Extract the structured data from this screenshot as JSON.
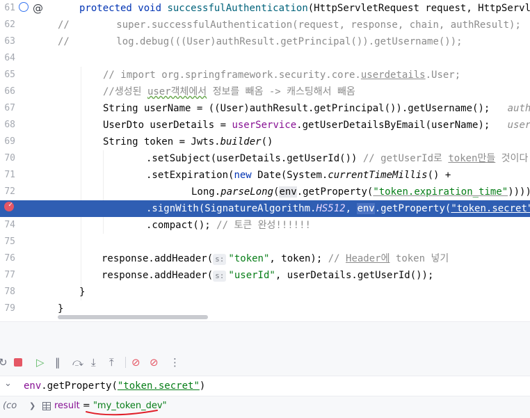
{
  "editor": {
    "line_numbers": [
      "61",
      "62",
      "63",
      "64",
      "65",
      "66",
      "67",
      "68",
      "69",
      "70",
      "71",
      "72",
      "73",
      "74",
      "75",
      "76",
      "77",
      "78",
      "79"
    ],
    "lines": {
      "l61": {
        "kw1": "protected",
        "kw2": "void",
        "meth": "successfulAuthentication",
        "rest": "(HttpServletRequest request, HttpServletRe"
      },
      "l62": "//        super.successfulAuthentication(request, response, chain, authResult);",
      "l63": "//        log.debug(((User)authResult.getPrincipal()).getUsername());",
      "l66": {
        "a": "// import org.springframework.security.core.",
        "b": "userdetails",
        "c": ".User;"
      },
      "l67": {
        "a": "//생성된 ",
        "b": "user객체에서",
        "c": " 정보를 빼옴 -> 캐스팅해서 빼옴"
      },
      "l68": {
        "code": "String userName = ((User)authResult.getPrincipal()).getUsername();",
        "hint": "authResul"
      },
      "l69": {
        "a": "UserDto userDetails = ",
        "field": "userService",
        "b": ".getUserDetailsByEmail(userName);",
        "hint": "userName:"
      },
      "l70": {
        "a": "String token = Jwts.",
        "it": "builder",
        "b": "()"
      },
      "l71": {
        "a": ".setSubject(userDetails.getUserId()) ",
        "c1": "// getUserId로 ",
        "c2": "token만들",
        "c3": " 것이다"
      },
      "l72": {
        "a": ".setExpiration(",
        "kw": "new",
        "b": " Date(System.",
        "it": "currentTimeMillis",
        "c": "() +"
      },
      "l73": {
        "a": "Long.",
        "it": "parseLong",
        "b": "(",
        "env": "env",
        "c": ".getProperty(",
        "str": "\"token.expiration_time\"",
        "d": ")))) //"
      },
      "l74": {
        "a": ".signWith(SignatureAlgorithm.",
        "hs": "HS512",
        "b": ", ",
        "env": "env",
        "c": ".getProperty(",
        "str": "\"token.secret\"",
        "d": "))"
      },
      "l75": {
        "a": ".compact(); ",
        "c": "// 토큰 완성!!!!!!"
      },
      "l77": {
        "a": "response.addHeader(",
        "hint": "s:",
        "str": "\"token\"",
        "b": ", token); ",
        "c1": "// ",
        "c2": "Header에",
        "c3": " token 넣기"
      },
      "l78": {
        "a": "response.addHeader(",
        "hint": "s:",
        "str": "\"userId\"",
        "b": ", userDetails.getUserId());"
      },
      "l79": "}",
      "l80": "}"
    }
  },
  "debug_toolbar": {
    "icons": [
      "rerun-icon",
      "stop-icon",
      "resume-icon",
      "pause-icon",
      "step-over-icon",
      "step-into-icon",
      "step-out-icon",
      "view-breakpoints-icon",
      "mute-breakpoints-icon",
      "more-icon"
    ]
  },
  "evaluate": {
    "expr_a": "env",
    "expr_b": ".getProperty(",
    "expr_str": "\"token.secret\"",
    "expr_c": ")"
  },
  "result": {
    "frame_label": "(co",
    "name": "result",
    "eq": " = ",
    "value": "\"my_token_dev\""
  },
  "colors": {
    "highlight": "#2f5eb3",
    "keyword": "#0033b3",
    "string": "#067d17",
    "comment": "#8c8c8c",
    "breakpoint": "#e55765",
    "annotation_red": "#e0202a"
  }
}
